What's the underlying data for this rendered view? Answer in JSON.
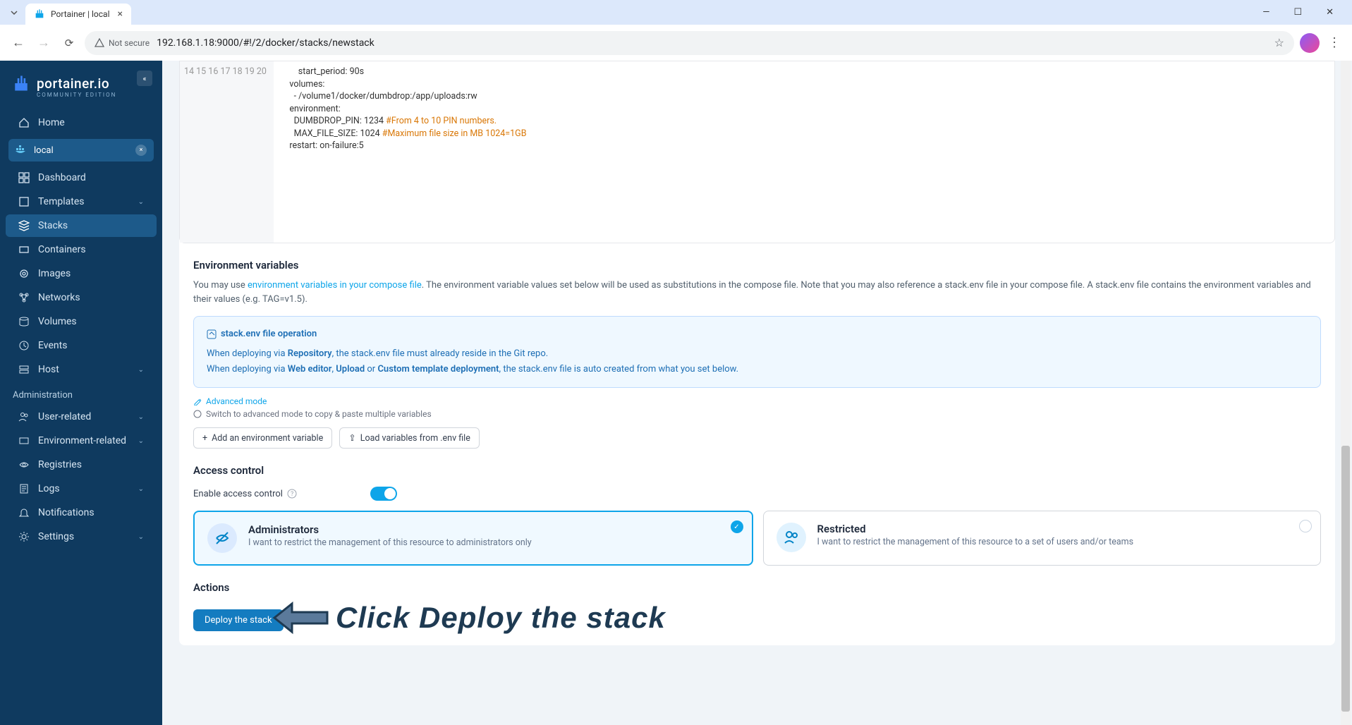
{
  "browser": {
    "tab_title": "Portainer | local",
    "security_text": "Not secure",
    "url": "192.168.1.18:9000/#!/2/docker/stacks/newstack"
  },
  "logo": {
    "name": "portainer.io",
    "edition": "COMMUNITY EDITION"
  },
  "sidebar": {
    "home": "Home",
    "env_name": "local",
    "items": [
      "Dashboard",
      "Templates",
      "Stacks",
      "Containers",
      "Images",
      "Networks",
      "Volumes",
      "Events",
      "Host"
    ],
    "admin_header": "Administration",
    "admin_items": [
      "User-related",
      "Environment-related",
      "Registries",
      "Logs",
      "Notifications",
      "Settings"
    ]
  },
  "editor": {
    "lines": [
      {
        "n": 14,
        "content": "        start_period: 90s"
      },
      {
        "n": 15,
        "content": "    volumes:"
      },
      {
        "n": 16,
        "content": "      - /volume1/docker/dumbdrop:/app/uploads:rw"
      },
      {
        "n": 17,
        "content": "    environment:"
      },
      {
        "n": 18,
        "content": "      DUMBDROP_PIN: 1234 ",
        "comment": "#From 4 to 10 PIN numbers."
      },
      {
        "n": 19,
        "content": "      MAX_FILE_SIZE: 1024 ",
        "comment": "#Maximum file size in MB 1024=1GB"
      },
      {
        "n": 20,
        "content": "    restart: on-failure:5"
      }
    ]
  },
  "env": {
    "title": "Environment variables",
    "desc_pre": "You may use ",
    "desc_link": "environment variables in your compose file",
    "desc_post": ". The environment variable values set below will be used as substitutions in the compose file. Note that you may also reference a stack.env file in your compose file. A stack.env file contains the environment variables and their values (e.g. TAG=v1.5).",
    "info_title": "stack.env file operation",
    "info_line1_pre": "When deploying via ",
    "info_line1_b1": "Repository",
    "info_line1_post": ", the stack.env file must already reside in the Git repo.",
    "info_line2_pre": "When deploying via ",
    "info_line2_b1": "Web editor",
    "info_line2_sep1": ", ",
    "info_line2_b2": "Upload",
    "info_line2_sep2": " or ",
    "info_line2_b3": "Custom template deployment",
    "info_line2_post": ", the stack.env file is auto created from what you set below.",
    "adv": "Advanced mode",
    "hint": "Switch to advanced mode to copy & paste multiple variables",
    "btn_add": "Add an environment variable",
    "btn_load": "Load variables from .env file"
  },
  "access": {
    "title": "Access control",
    "enable": "Enable access control",
    "admin_title": "Administrators",
    "admin_desc": "I want to restrict the management of this resource to administrators only",
    "restricted_title": "Restricted",
    "restricted_desc": "I want to restrict the management of this resource to a set of users and/or teams"
  },
  "actions": {
    "title": "Actions",
    "deploy": "Deploy the stack"
  },
  "annotation": {
    "text": "Click Deploy the stack"
  }
}
